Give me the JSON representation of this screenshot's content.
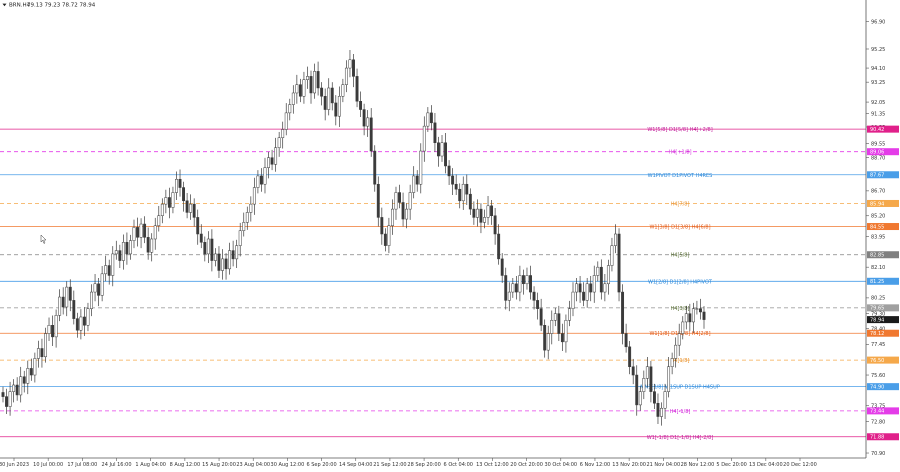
{
  "chart_data": {
    "type": "candlestick",
    "symbol_header": "BRN.H4",
    "ohlc_header": "79.13 79.23 78.72 78.94",
    "y_ticks": [
      "96.90",
      "95.25",
      "94.10",
      "93.25",
      "92.05",
      "91.35",
      "90.55",
      "89.55",
      "88.70",
      "86.70",
      "85.20",
      "83.95",
      "82.10",
      "80.25",
      "79.30",
      "78.40",
      "77.45",
      "75.60",
      "73.75",
      "72.80",
      "70.90"
    ],
    "ylim": [
      70.6,
      97.6
    ],
    "x_ticks": [
      "30 Jun 2023",
      "10 Jul 00:00",
      "17 Jul 08:00",
      "24 Jul 16:00",
      "1 Aug 04:00",
      "8 Aug 12:00",
      "15 Aug 20:00",
      "23 Aug 04:00",
      "30 Aug 12:00",
      "6 Sep 20:00",
      "14 Sep 04:00",
      "21 Sep 12:00",
      "28 Sep 20:00",
      "6 Oct 04:00",
      "13 Oct 12:00",
      "20 Oct 20:00",
      "30 Oct 04:00",
      "6 Nov 12:00",
      "13 Nov 20:00",
      "21 Nov 04:00",
      "28 Nov 12:00",
      "5 Dec 20:00",
      "13 Dec 04:00",
      "20 Dec 12:00"
    ],
    "close_series": [
      74.3,
      73.7,
      74.6,
      75.0,
      74.4,
      75.5,
      75.1,
      76.0,
      75.6,
      76.6,
      77.2,
      76.7,
      78.1,
      78.6,
      77.9,
      79.2,
      80.3,
      79.7,
      80.9,
      80.1,
      79.0,
      78.3,
      79.1,
      78.6,
      79.6,
      80.6,
      81.1,
      80.4,
      81.7,
      82.2,
      81.6,
      82.9,
      83.1,
      82.5,
      83.6,
      82.9,
      83.7,
      84.5,
      83.9,
      84.7,
      83.9,
      83.0,
      83.8,
      84.6,
      85.2,
      85.9,
      86.3,
      85.7,
      86.6,
      87.4,
      86.9,
      86.1,
      85.4,
      85.9,
      85.1,
      84.1,
      83.6,
      82.9,
      83.8,
      82.5,
      82.9,
      81.9,
      82.6,
      82.0,
      83.1,
      82.6,
      83.4,
      84.3,
      84.8,
      85.4,
      85.9,
      86.9,
      87.6,
      87.1,
      88.1,
      88.7,
      88.3,
      89.3,
      89.9,
      90.4,
      91.4,
      91.9,
      92.6,
      93.1,
      92.4,
      93.4,
      93.6,
      92.6,
      93.9,
      92.9,
      92.4,
      91.6,
      92.9,
      92.0,
      91.2,
      92.4,
      93.1,
      94.1,
      94.6,
      93.6,
      92.1,
      91.6,
      90.6,
      91.1,
      89.1,
      87.1,
      85.1,
      84.1,
      83.4,
      84.6,
      85.6,
      86.6,
      86.0,
      85.0,
      85.6,
      86.6,
      87.6,
      87.1,
      89.1,
      90.6,
      91.4,
      90.8,
      89.6,
      88.8,
      89.6,
      88.2,
      87.6,
      87.1,
      86.8,
      86.1,
      87.1,
      86.5,
      85.6,
      85.1,
      85.6,
      84.8,
      85.1,
      85.8,
      85.2,
      84.1,
      82.6,
      81.6,
      80.1,
      80.6,
      81.1,
      80.6,
      81.6,
      81.1,
      81.6,
      80.6,
      80.1,
      79.6,
      78.6,
      77.1,
      78.1,
      78.9,
      79.3,
      78.1,
      77.6,
      78.9,
      79.6,
      80.6,
      81.1,
      80.6,
      80.1,
      81.1,
      80.6,
      81.6,
      82.1,
      80.6,
      81.1,
      82.2,
      83.4,
      84.1,
      80.6,
      78.1,
      77.3,
      76.1,
      75.6,
      73.8,
      74.6,
      75.4,
      76.1,
      74.6,
      73.9,
      73.1,
      73.6,
      74.6,
      76.1,
      76.6,
      77.4,
      78.1,
      78.8,
      79.3,
      78.8,
      79.6,
      79.6,
      79.4,
      78.94
    ],
    "levels": [
      {
        "label": "W1[5/8] D1[5/8] H4[+2/8]",
        "price_text": "90.42",
        "value": 90.42,
        "color": "#e0208a",
        "dash": "solid",
        "label_color": "#c0189a"
      },
      {
        "label": "H4[+1/8]",
        "price_text": "89.06",
        "value": 89.06,
        "color": "#e43ce8",
        "dash": "dash",
        "label_color": "#d028d8"
      },
      {
        "label": "W1PIVOT D1PIVOT H4RES",
        "price_text": "87.67",
        "value": 87.67,
        "color": "#4a9ee8",
        "dash": "solid",
        "label_color": "#2d88d8"
      },
      {
        "label": "H4[7/8]",
        "price_text": "85.94",
        "value": 85.94,
        "color": "#f5a84a",
        "dash": "dash",
        "label_color": "#e8902a"
      },
      {
        "label": "W1[3/8] D1[3/8] H4[6/8]",
        "price_text": "84.55",
        "value": 84.55,
        "color": "#f07830",
        "dash": "solid",
        "label_color": "#e05818"
      },
      {
        "label": "H4[5/8]",
        "price_text": "82.85",
        "value": 82.85,
        "color": "#808080",
        "dash": "dash",
        "label_color": "#556b2f"
      },
      {
        "label": "W1[2/8] D1[2/8] H4PIVOT",
        "price_text": "81.25",
        "value": 81.25,
        "color": "#4a9ee8",
        "dash": "solid",
        "label_color": "#2d88d8"
      },
      {
        "label": "H4[3/8]",
        "price_text": "79.65",
        "value": 79.65,
        "color": "#a0a0a0",
        "dash": "dash",
        "label_color": "#556b2f"
      },
      {
        "label": "W1[1/8] D1[1/8] H4[2/8]",
        "price_text": "78.12",
        "value": 78.12,
        "color": "#f07830",
        "dash": "solid",
        "label_color": "#e05818"
      },
      {
        "label": "H4[1/8]",
        "price_text": "76.50",
        "value": 76.5,
        "color": "#f5a84a",
        "dash": "dash",
        "label_color": "#e8902a"
      },
      {
        "label": "MN1[3/8] W1SUP D1SUP H4SUP",
        "price_text": "74.90",
        "value": 74.9,
        "color": "#4a9ee8",
        "dash": "solid",
        "label_color": "#2d88d8"
      },
      {
        "label": "H4[-1/8]",
        "price_text": "73.44",
        "value": 73.44,
        "color": "#e43ce8",
        "dash": "dash",
        "label_color": "#d028d8"
      },
      {
        "label": "W1[-1/8] D1[-1/8] H4[-2/8]",
        "price_text": "71.88",
        "value": 71.88,
        "color": "#e0208a",
        "dash": "solid",
        "label_color": "#c0189a"
      }
    ],
    "current_price": "78.94",
    "colors": {
      "candle": "#3a3a3a",
      "axis": "#555555",
      "background": "#ffffff",
      "grey_tag": "#6b8e23",
      "dark_tag": "#1a1a1a"
    }
  }
}
